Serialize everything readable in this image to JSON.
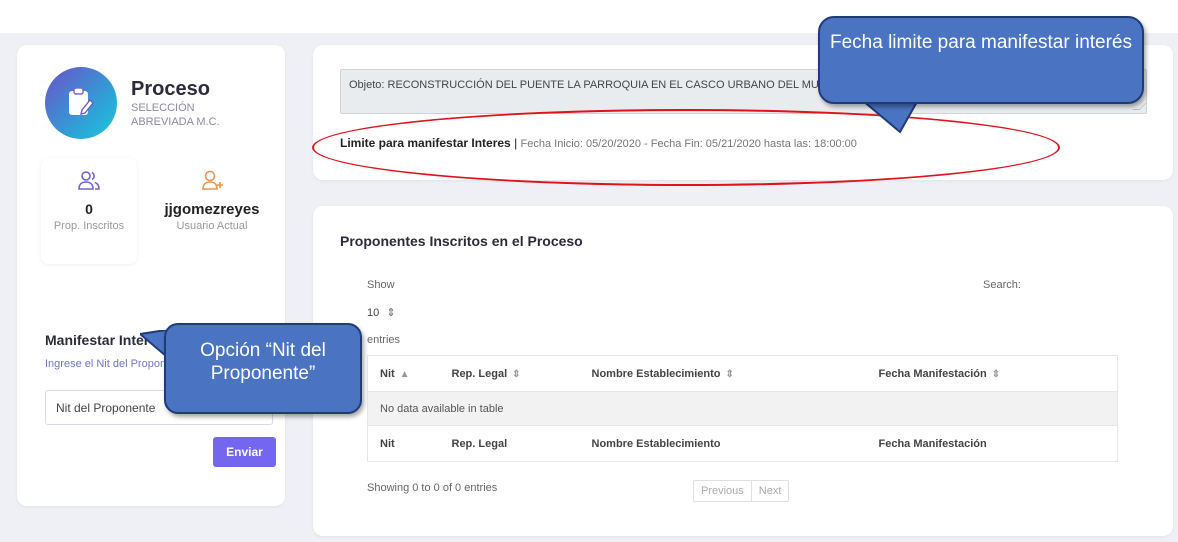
{
  "process": {
    "title": "Proceso",
    "subtitle": "SELECCIÓN ABREVIADA M.C."
  },
  "stats": [
    {
      "value": "0",
      "label": "Prop. Inscritos",
      "icon": "users-icon"
    },
    {
      "value": "jjgomezreyes",
      "label": "Usuario Actual",
      "icon": "user-plus-icon"
    }
  ],
  "manifest": {
    "title": "Manifestar Interés",
    "hint": "Ingrese el Nit del Proponente",
    "placeholder": "Nit del Proponente",
    "button": "Enviar"
  },
  "objeto": {
    "text": "Objeto: RECONSTRUCCIÓN DEL PUENTE LA PARROQUIA EN EL CASCO URBANO DEL MUNICIPIO"
  },
  "limite": {
    "label": "Limite para manifestar Interes",
    "separator": " | ",
    "dates": "Fecha Inicio: 05/20/2020 - Fecha Fin: 05/21/2020 hasta las: 18:00:00"
  },
  "table_section": {
    "title": "Proponentes Inscritos en el Proceso",
    "show_label": "Show",
    "page_size": "10",
    "entries_label": "entries",
    "search_label": "Search:",
    "columns": [
      "Nit",
      "Rep. Legal",
      "Nombre Establecimiento",
      "Fecha Manifestación"
    ],
    "empty_message": "No data available in table",
    "info": "Showing 0 to 0 of 0 entries",
    "prev": "Previous",
    "next": "Next"
  },
  "callouts": {
    "fecha": "Fecha limite para manifestar interés",
    "nit": "Opción “Nit del Proponente”"
  },
  "colors": {
    "accent": "#7367f0",
    "callout": "#4a73c2",
    "highlight": "#e1121b"
  }
}
